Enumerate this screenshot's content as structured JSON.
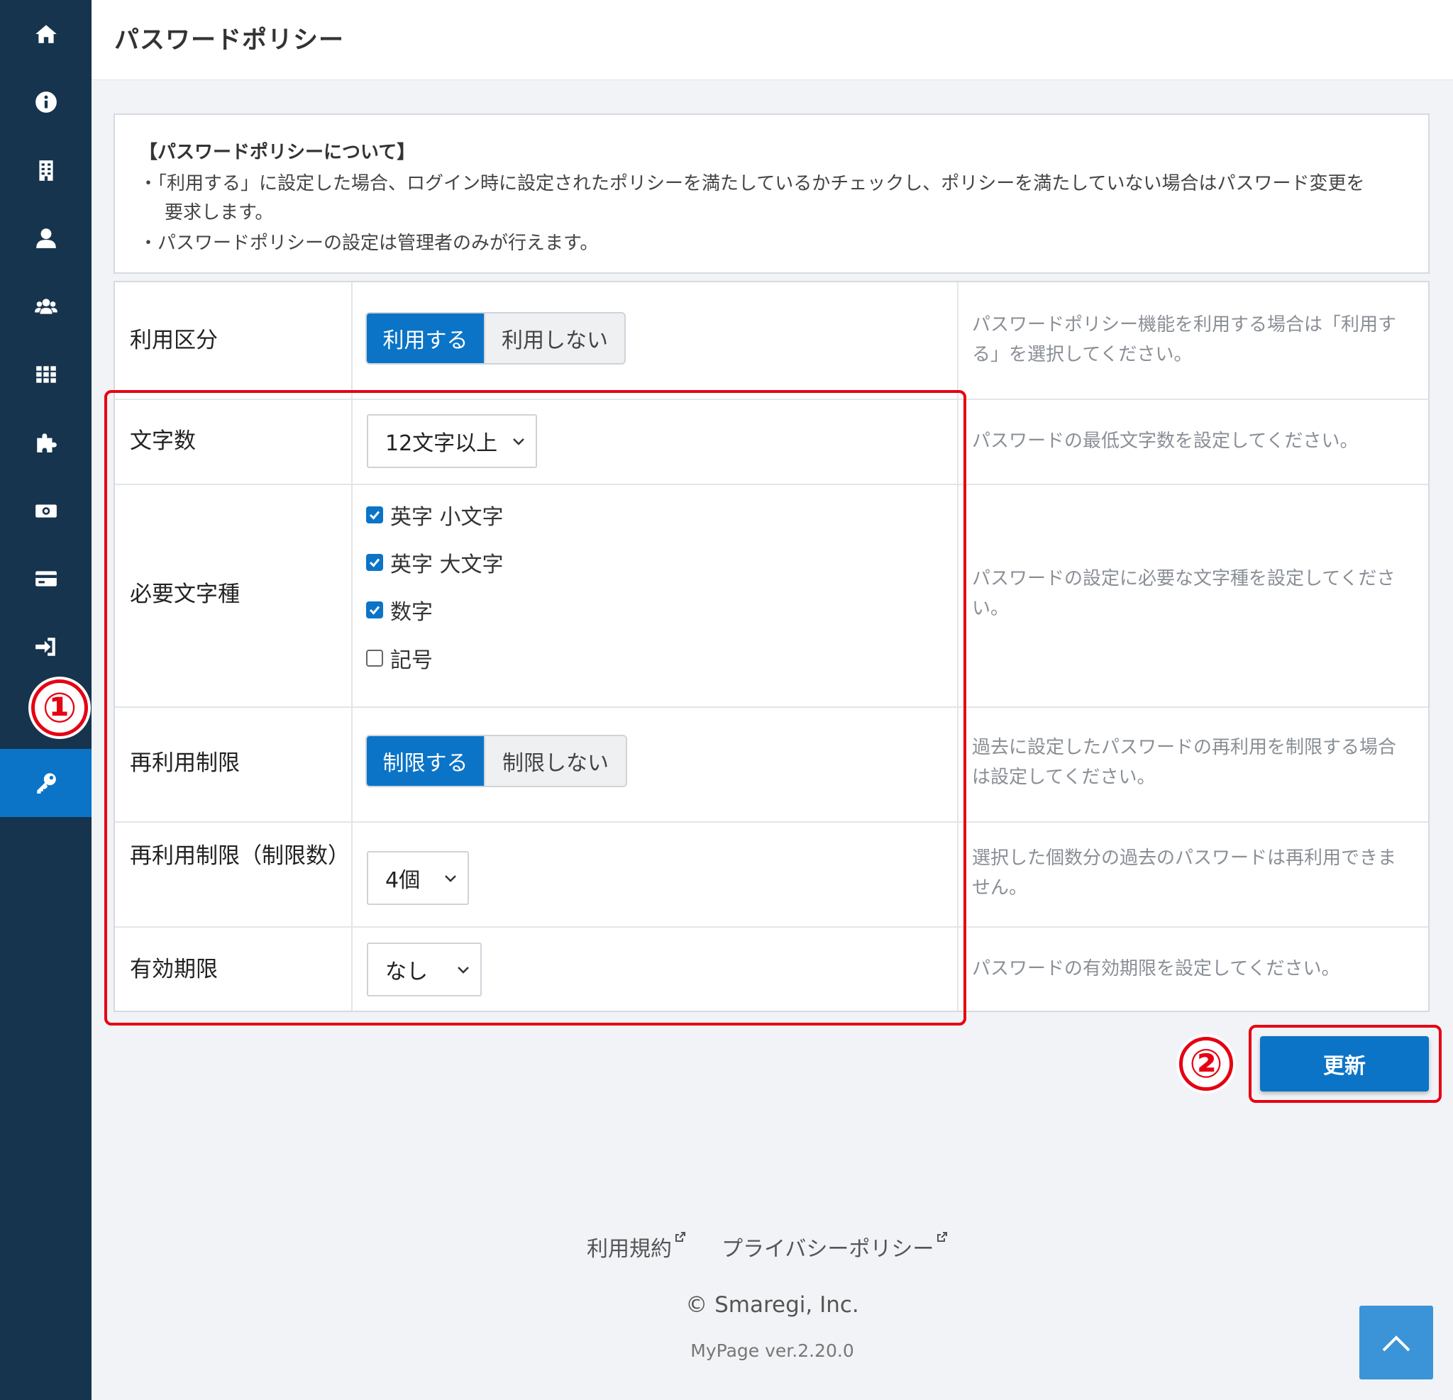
{
  "header": {
    "title": "パスワードポリシー"
  },
  "sidebar": {
    "items": [
      {
        "icon": "home-icon"
      },
      {
        "icon": "info-icon"
      },
      {
        "icon": "building-icon"
      },
      {
        "icon": "user-icon"
      },
      {
        "icon": "users-icon"
      },
      {
        "icon": "grid-icon"
      },
      {
        "icon": "puzzle-icon"
      },
      {
        "icon": "money-icon"
      },
      {
        "icon": "credit-card-icon"
      },
      {
        "icon": "sign-in-icon"
      },
      {
        "icon": "calendar-icon"
      },
      {
        "icon": "key-icon",
        "active": true
      }
    ]
  },
  "info": {
    "title": "【パスワードポリシーについて】",
    "line1": "・「利用する」に設定した場合、ログイン時に設定されたポリシーを満たしているかチェックし、ポリシーを満たしていない場合はパスワード変更を",
    "line2": "要求します。",
    "line3": "・パスワードポリシーの設定は管理者のみが行えます。"
  },
  "form": {
    "usage": {
      "label": "利用区分",
      "on": "利用する",
      "off": "利用しない",
      "help": "パスワードポリシー機能を利用する場合は「利用する」を選択してください。"
    },
    "length": {
      "label": "文字数",
      "value": "12文字以上",
      "help": "パスワードの最低文字数を設定してください。"
    },
    "chartypes": {
      "label": "必要文字種",
      "options": [
        {
          "label": "英字 小文字",
          "checked": true
        },
        {
          "label": "英字 大文字",
          "checked": true
        },
        {
          "label": "数字",
          "checked": true
        },
        {
          "label": "記号",
          "checked": false
        }
      ],
      "help": "パスワードの設定に必要な文字種を設定してください。"
    },
    "reuse": {
      "label": "再利用制限",
      "on": "制限する",
      "off": "制限しない",
      "help": "過去に設定したパスワードの再利用を制限する場合は設定してください。"
    },
    "reuse_count": {
      "label": "再利用制限（制限数）",
      "value": "4個",
      "help": "選択した個数分の過去のパスワードは再利用できません。"
    },
    "expiry": {
      "label": "有効期限",
      "value": "なし",
      "help": "パスワードの有効期限を設定してください。"
    }
  },
  "update_label": "更新",
  "annotations": {
    "one": "①",
    "two": "②"
  },
  "footer": {
    "terms": "利用規約",
    "privacy": "プライバシーポリシー",
    "copyright": "© Smaregi, Inc.",
    "version": "MyPage ver.2.20.0"
  },
  "colors": {
    "sidebar": "#16344d",
    "accent": "#0b74c7",
    "annotation": "#e60012"
  }
}
